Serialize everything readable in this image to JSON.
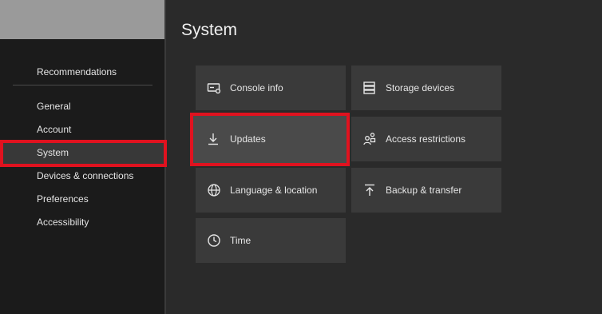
{
  "sidebar": {
    "items": [
      {
        "label": "Recommendations"
      },
      {
        "label": "General"
      },
      {
        "label": "Account"
      },
      {
        "label": "System"
      },
      {
        "label": "Devices & connections"
      },
      {
        "label": "Preferences"
      },
      {
        "label": "Accessibility"
      }
    ],
    "selected": "System"
  },
  "main": {
    "title": "System",
    "tiles": [
      {
        "label": "Console info",
        "icon": "console-info-icon"
      },
      {
        "label": "Storage devices",
        "icon": "storage-icon"
      },
      {
        "label": "Updates",
        "icon": "download-icon"
      },
      {
        "label": "Access restrictions",
        "icon": "people-lock-icon"
      },
      {
        "label": "Language & location",
        "icon": "globe-icon"
      },
      {
        "label": "Backup & transfer",
        "icon": "upload-icon"
      },
      {
        "label": "Time",
        "icon": "clock-icon"
      }
    ],
    "selected": "Updates"
  },
  "colors": {
    "background": "#2a2a2a",
    "sidebar": "#1b1b1b",
    "tile": "#3a3a3a",
    "highlight": "#e0121f",
    "text": "#e6e6e6"
  }
}
